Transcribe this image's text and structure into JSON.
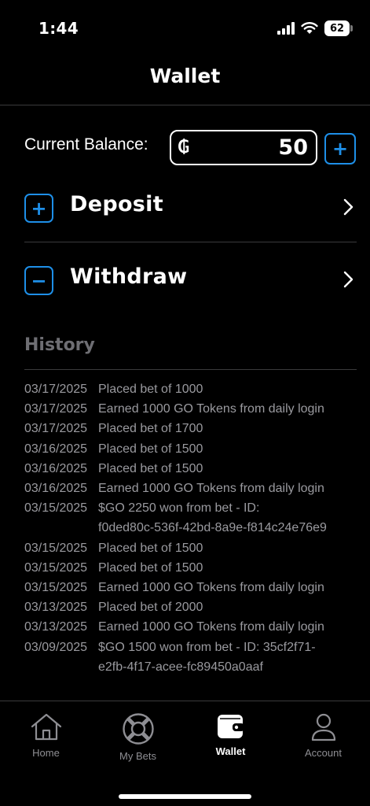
{
  "status_bar": {
    "time": "1:44",
    "battery": "62",
    "icons": [
      "signal-icon",
      "wifi-icon",
      "battery-icon"
    ]
  },
  "header": {
    "title": "Wallet"
  },
  "balance": {
    "label": "Current Balance:",
    "currency_symbol": "₲",
    "value": "50",
    "add_label": "+"
  },
  "actions": {
    "deposit": {
      "label": "Deposit",
      "icon_symbol": "+"
    },
    "withdraw": {
      "label": "Withdraw",
      "icon_symbol": "−"
    }
  },
  "history": {
    "title": "History",
    "items": [
      {
        "date": "03/17/2025",
        "description": "Placed bet of 1000"
      },
      {
        "date": "03/17/2025",
        "description": "Earned 1000 GO Tokens from daily login"
      },
      {
        "date": "03/17/2025",
        "description": "Placed bet of 1700"
      },
      {
        "date": "03/16/2025",
        "description": "Placed bet of 1500"
      },
      {
        "date": "03/16/2025",
        "description": "Placed bet of 1500"
      },
      {
        "date": "03/16/2025",
        "description": "Earned 1000 GO Tokens from daily login"
      },
      {
        "date": "03/15/2025",
        "description": "$GO 2250 won from bet - ID:\nf0ded80c-536f-42bd-8a9e-f814c24e76e9"
      },
      {
        "date": "03/15/2025",
        "description": "Placed bet of 1500"
      },
      {
        "date": "03/15/2025",
        "description": "Placed bet of 1500"
      },
      {
        "date": "03/15/2025",
        "description": "Earned 1000 GO Tokens from daily login"
      },
      {
        "date": "03/13/2025",
        "description": "Placed bet of 2000"
      },
      {
        "date": "03/13/2025",
        "description": "Earned 1000 GO Tokens from daily login"
      },
      {
        "date": "03/09/2025",
        "description": "$GO 1500 won from bet - ID: 35cf2f71-\ne2fb-4f17-acee-fc89450a0aaf"
      }
    ]
  },
  "tab_bar": {
    "tabs": [
      {
        "label": "Home",
        "icon": "home-icon",
        "active": false
      },
      {
        "label": "My Bets",
        "icon": "lifebuoy-icon",
        "active": false
      },
      {
        "label": "Wallet",
        "icon": "wallet-icon",
        "active": true
      },
      {
        "label": "Account",
        "icon": "person-icon",
        "active": false
      }
    ]
  },
  "colors": {
    "accent": "#1e8fe8",
    "background": "#000000",
    "muted": "#9a9a9f"
  }
}
